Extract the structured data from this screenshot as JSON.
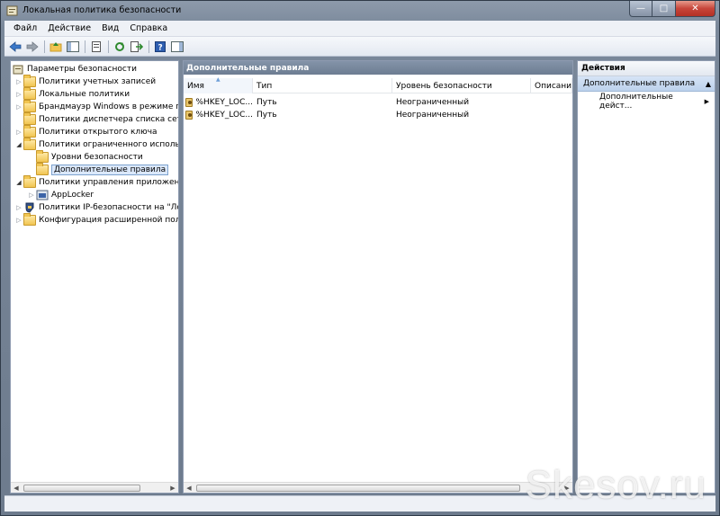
{
  "window": {
    "title": "Локальная политика безопасности",
    "icon": "security-policy-icon",
    "controls": {
      "minimize": "—",
      "maximize": "□",
      "close": "✕"
    }
  },
  "menu": [
    "Файл",
    "Действие",
    "Вид",
    "Справка"
  ],
  "toolbar": [
    "back-icon",
    "forward-icon",
    "up-folder-icon",
    "show-tree-icon",
    "properties-icon",
    "refresh-icon",
    "export-icon",
    "help-icon",
    "show-action-pane-icon"
  ],
  "tree": {
    "root": "Параметры безопасности",
    "items": [
      {
        "label": "Политики учетных записей",
        "icon": "folder"
      },
      {
        "label": "Локальные политики",
        "icon": "folder"
      },
      {
        "label": "Брандмауэр Windows в режиме пов",
        "icon": "folder"
      },
      {
        "label": "Политики диспетчера списка сетей",
        "icon": "folder"
      },
      {
        "label": "Политики открытого ключа",
        "icon": "folder"
      },
      {
        "label": "Политики ограниченного использо",
        "icon": "folder"
      },
      {
        "label": "Уровни безопасности",
        "icon": "folder"
      },
      {
        "label": "Дополнительные правила",
        "icon": "folder",
        "selected": true
      },
      {
        "label": "Политики управления приложения",
        "icon": "folder"
      },
      {
        "label": "AppLocker",
        "icon": "applocker"
      },
      {
        "label": "Политики IP-безопасности на \"Лока",
        "icon": "shield"
      },
      {
        "label": "Конфигурация расширенной полит",
        "icon": "folder"
      }
    ]
  },
  "content": {
    "header": "Дополнительные правила",
    "columns": [
      "Имя",
      "Тип",
      "Уровень безопасности",
      "Описание"
    ],
    "rows": [
      {
        "name": "%HKEY_LOC...",
        "type": "Путь",
        "level": "Неограниченный",
        "description": ""
      },
      {
        "name": "%HKEY_LOC...",
        "type": "Путь",
        "level": "Неограниченный",
        "description": ""
      }
    ]
  },
  "actions": {
    "title": "Действия",
    "group": "Дополнительные правила",
    "item": "Дополнительные дейст..."
  },
  "watermark": "Skesov.ru"
}
